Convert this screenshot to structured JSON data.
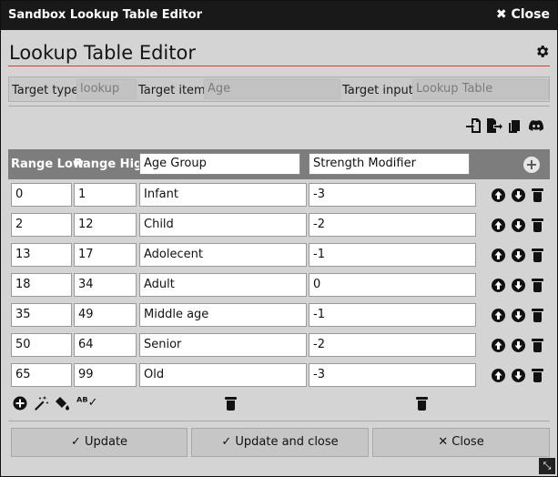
{
  "window": {
    "title": "Sandbox Lookup Table Editor",
    "close_label": "Close",
    "close_glyph": "✖"
  },
  "editor": {
    "heading": "Lookup Table Editor",
    "settings_icon": "gear-icon"
  },
  "target": {
    "type_label": "Target type",
    "type_value": "lookup",
    "item_label": "Target item",
    "item_value": "Age",
    "input_label": "Target input",
    "input_value": "Lookup Table"
  },
  "toolbar_icons": [
    "import-file-icon",
    "export-file-icon",
    "copy-icon",
    "discord-icon"
  ],
  "table": {
    "col_range_low": "Range Low",
    "col_range_high": "Range High",
    "col_name_a": "Age Group",
    "col_name_b": "Strength Modifier",
    "rows": [
      {
        "low": "0",
        "high": "1",
        "a": "Infant",
        "b": "-3"
      },
      {
        "low": "2",
        "high": "12",
        "a": "Child",
        "b": "-2"
      },
      {
        "low": "13",
        "high": "17",
        "a": "Adolecent",
        "b": "-1"
      },
      {
        "low": "18",
        "high": "34",
        "a": "Adult",
        "b": "0"
      },
      {
        "low": "35",
        "high": "49",
        "a": "Middle age",
        "b": "-1"
      },
      {
        "low": "50",
        "high": "64",
        "a": "Senior",
        "b": "-2"
      },
      {
        "low": "65",
        "high": "99",
        "a": "Old",
        "b": "-3"
      }
    ]
  },
  "bottom_tools": [
    "add-row-icon",
    "magic-wand-icon",
    "fill-icon",
    "spellcheck-icon"
  ],
  "spellcheck_glyph": "ᴬᴮ✓",
  "footer": {
    "update_label": "✓ Update",
    "update_close_label": "✓ Update and close",
    "close_label": "✕ Close"
  },
  "colors": {
    "titlebar": "#191919",
    "header": "#7d7d7d",
    "accent_line": "#c84040"
  }
}
